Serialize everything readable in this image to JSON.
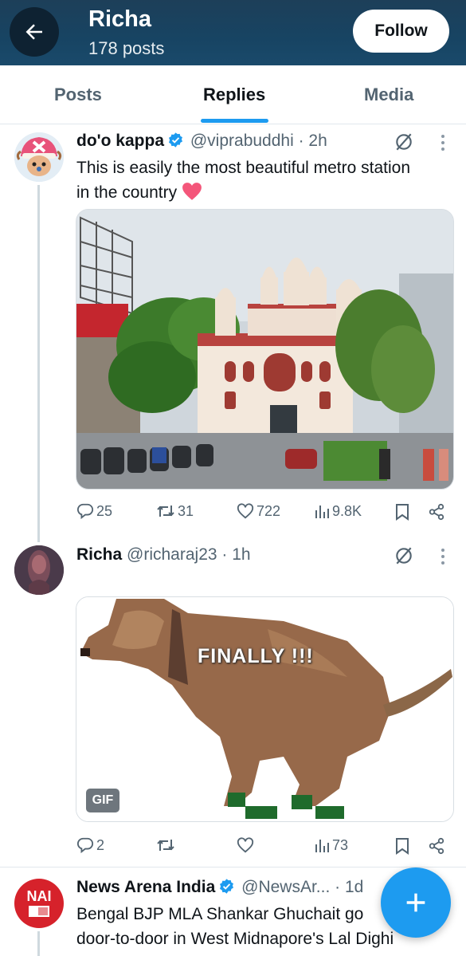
{
  "header": {
    "name": "Richa",
    "posts_count": "178 posts",
    "follow_label": "Follow"
  },
  "tabs": [
    {
      "label": "Posts",
      "active": false
    },
    {
      "label": "Replies",
      "active": true
    },
    {
      "label": "Media",
      "active": false
    }
  ],
  "posts": [
    {
      "name": "do'o kappa",
      "verified": true,
      "handle": "@viprabuddhi",
      "time": "· 2h",
      "text_line1": "This is easily the most beautiful metro station",
      "text_line2": "in the country",
      "emoji": "heart",
      "media": "photo of ornate red-and-white temple style metro station",
      "actions": {
        "replies": "25",
        "reposts": "31",
        "likes": "722",
        "views": "9.8K"
      }
    },
    {
      "name": "Richa",
      "verified": false,
      "handle": "@richaraj23",
      "time": "· 1h",
      "gif_caption": "FINALLY !!!",
      "gif_badge": "GIF",
      "actions": {
        "replies": "2",
        "reposts": "",
        "likes": "",
        "views": "73"
      }
    },
    {
      "name": "News Arena India",
      "verified": true,
      "handle": "@NewsAr...",
      "time": "· 1d",
      "avatar_text": "NAI",
      "text_line1": "Bengal BJP MLA Shankar Ghuchait go",
      "text_line2": "door-to-door in West Midnapore's Lal Dighi"
    }
  ],
  "colors": {
    "header_bg": "#174463",
    "accent": "#1d9bf0",
    "text_secondary": "#536471"
  },
  "icons": [
    "back-arrow-icon",
    "verified-badge-icon",
    "grok-icon",
    "more-icon",
    "reply-icon",
    "repost-icon",
    "like-icon",
    "views-icon",
    "bookmark-icon",
    "share-icon",
    "compose-plus-icon"
  ]
}
